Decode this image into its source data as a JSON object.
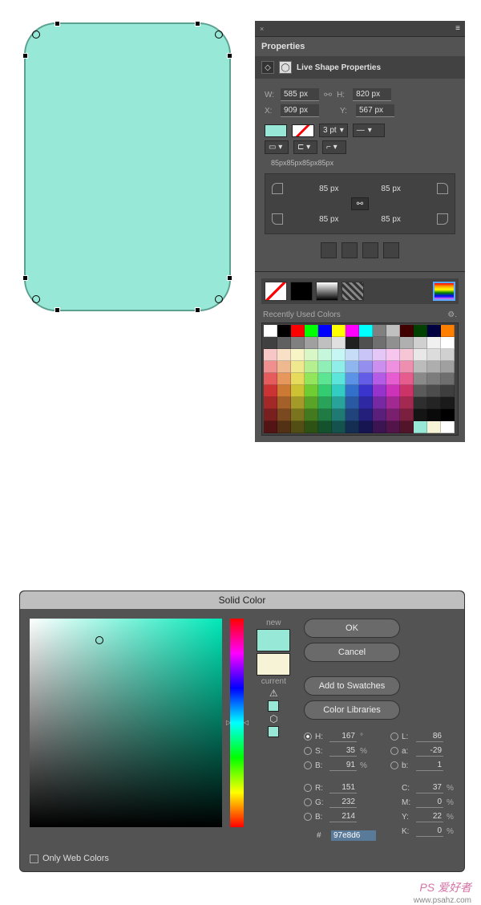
{
  "shape": {
    "fill": "#97e8d6"
  },
  "properties": {
    "tab_close": "×",
    "title": "Properties",
    "header": "Live Shape Properties",
    "w_label": "W:",
    "w": "585 px",
    "h_label": "H:",
    "h": "820 px",
    "x_label": "X:",
    "x": "909 px",
    "y_label": "Y:",
    "y": "567 px",
    "stroke_weight": "3 pt",
    "corner_summary": "85px85px85px85px",
    "corners": {
      "tl": "85 px",
      "tr": "85 px",
      "bl": "85 px",
      "br": "85 px"
    }
  },
  "fill_panel": {
    "recent_label": "Recently Used Colors",
    "swatch_rows": [
      [
        "#ffffff",
        "#000000",
        "#ff0000",
        "#00ff00",
        "#0000ff",
        "#ffff00",
        "#ff00ff",
        "#00ffff",
        "#808080",
        "#c0c0c0",
        "#400000",
        "#004000",
        "#000040",
        "#ff8000"
      ],
      [
        "#404040",
        "#606060",
        "#808080",
        "#a0a0a0",
        "#c0c0c0",
        "#e0e0e0",
        "#202020",
        "#505050",
        "#707070",
        "#909090",
        "#b0b0b0",
        "#d0d0d0",
        "#f0f0f0",
        "#ffffff"
      ],
      [
        "#f7c6c6",
        "#f7e0c6",
        "#f7f5c6",
        "#d9f7c6",
        "#c6f7dc",
        "#c6f7f5",
        "#c6dcf7",
        "#c9c6f7",
        "#e4c6f7",
        "#f7c6ef",
        "#f7c6d6",
        "#e8e8e8",
        "#dcdcdc",
        "#d0d0d0"
      ],
      [
        "#ef8f8f",
        "#efb98f",
        "#efe88f",
        "#b6ef8f",
        "#8fefb6",
        "#8fefe8",
        "#8fb6ef",
        "#948fef",
        "#cc8fef",
        "#ef8fe0",
        "#ef8fb0",
        "#bcbcbc",
        "#aeaeae",
        "#a0a0a0"
      ],
      [
        "#e65c5c",
        "#e6985c",
        "#e6db5c",
        "#93e65c",
        "#5ce693",
        "#5ce6db",
        "#5c93e6",
        "#635ce6",
        "#b45ce6",
        "#e65cd1",
        "#e65c8c",
        "#8a8a8a",
        "#7c7c7c",
        "#6e6e6e"
      ],
      [
        "#cc3333",
        "#cc7a33",
        "#ccc233",
        "#70cc33",
        "#33cc70",
        "#33ccc2",
        "#3370cc",
        "#3a33cc",
        "#9633cc",
        "#cc33b8",
        "#cc3366",
        "#5a5a5a",
        "#4c4c4c",
        "#3e3e3e"
      ],
      [
        "#a32929",
        "#a36129",
        "#a39a29",
        "#59a329",
        "#29a359",
        "#29a39a",
        "#2959a3",
        "#2e29a3",
        "#7729a3",
        "#a32992",
        "#a32951",
        "#2e2e2e",
        "#242424",
        "#1a1a1a"
      ],
      [
        "#7a1f1f",
        "#7a491f",
        "#7a741f",
        "#437a1f",
        "#1f7a43",
        "#1f7a74",
        "#1f437a",
        "#231f7a",
        "#591f7a",
        "#7a1f6d",
        "#7a1f3d",
        "#141414",
        "#0a0a0a",
        "#000000"
      ],
      [
        "#521414",
        "#523114",
        "#524e14",
        "#2d5214",
        "#14522d",
        "#14524e",
        "#142d52",
        "#171452",
        "#3c1452",
        "#521449",
        "#521429",
        "#97e8d6",
        "#f7f3d6",
        "#ffffff"
      ]
    ]
  },
  "solid_color": {
    "title": "Solid Color",
    "new_label": "new",
    "current_label": "current",
    "new_color": "#97e8d6",
    "current_color": "#f7f3d6",
    "ok": "OK",
    "cancel": "Cancel",
    "add": "Add to Swatches",
    "libs": "Color Libraries",
    "only_web": "Only Web Colors",
    "hsb": {
      "H_l": "H:",
      "H": "167",
      "H_u": "°",
      "S_l": "S:",
      "S": "35",
      "S_u": "%",
      "B_l": "B:",
      "B": "91",
      "B_u": "%"
    },
    "rgb": {
      "R_l": "R:",
      "R": "151",
      "G_l": "G:",
      "G": "232",
      "B_l": "B:",
      "B": "214"
    },
    "lab": {
      "L_l": "L:",
      "L": "86",
      "a_l": "a:",
      "a": "-29",
      "b_l": "b:",
      "b": "1"
    },
    "cmyk": {
      "C_l": "C:",
      "C": "37",
      "C_u": "%",
      "M_l": "M:",
      "M": "0",
      "M_u": "%",
      "Y_l": "Y:",
      "Y": "22",
      "Y_u": "%",
      "K_l": "K:",
      "K": "0",
      "K_u": "%"
    },
    "hash": "#",
    "hex": "97e8d6"
  },
  "watermark": {
    "logo": "PS 爱好者",
    "url": "www.psahz.com"
  }
}
